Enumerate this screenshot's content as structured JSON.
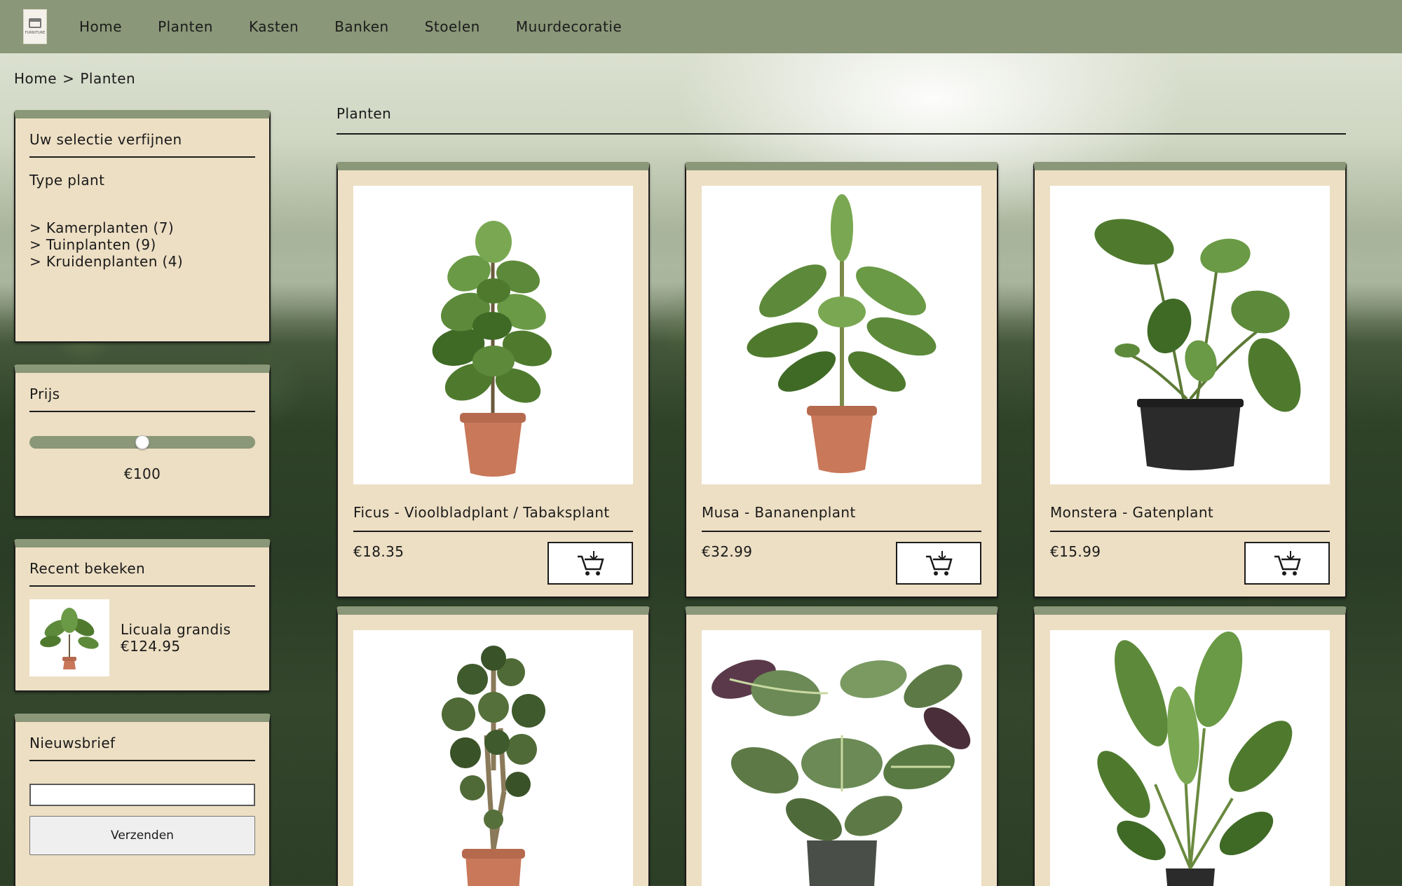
{
  "nav": {
    "logo_text": "FURNITURE",
    "items": [
      "Home",
      "Planten",
      "Kasten",
      "Banken",
      "Stoelen",
      "Muurdecoratie"
    ]
  },
  "breadcrumb": {
    "home": "Home",
    "separator": ">",
    "current": "Planten"
  },
  "sidebar": {
    "refine": {
      "title": "Uw selectie verfijnen",
      "type_title": "Type plant",
      "types": [
        "> Kamerplanten (7)",
        "> Tuinplanten (9)",
        "> Kruidenplanten (4)"
      ]
    },
    "price": {
      "title": "Prijs",
      "value_label": "€100",
      "slider_fraction": 0.5
    },
    "recent": {
      "title": "Recent bekeken",
      "item_name": "Licuala grandis",
      "item_price": "€124.95"
    },
    "newsletter": {
      "title": "Nieuwsbrief",
      "input_value": "",
      "button_label": "Verzenden"
    }
  },
  "main": {
    "title": "Planten",
    "products": [
      {
        "name": "Ficus - Vioolbladplant / Tabaksplant",
        "price": "€18.35",
        "pot": "terracotta"
      },
      {
        "name": "Musa - Bananenplant",
        "price": "€32.99",
        "pot": "terracotta"
      },
      {
        "name": "Monstera - Gatenplant",
        "price": "€15.99",
        "pot": "black"
      },
      {
        "name": "",
        "price": "",
        "pot": "terracotta"
      },
      {
        "name": "",
        "price": "",
        "pot": "grey"
      },
      {
        "name": "",
        "price": "",
        "pot": "black"
      }
    ]
  },
  "colors": {
    "nav_bg": "#8a9778",
    "panel_bg": "#eddfc4",
    "terracotta": "#c9785a",
    "black_pot": "#2b2b2b",
    "grey_pot": "#4a4e48",
    "leaf": "#4f7a2e"
  },
  "icons": {
    "cart": "cart-download-icon",
    "logo": "furniture-logo"
  }
}
